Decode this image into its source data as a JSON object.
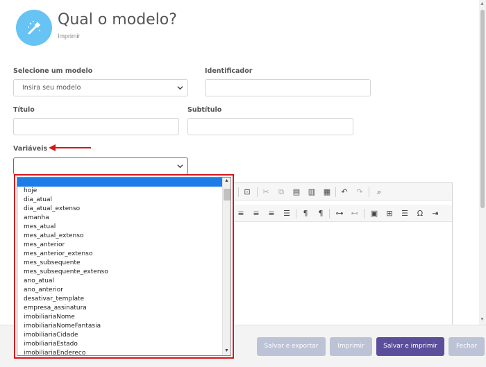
{
  "header": {
    "title": "Qual o modelo?",
    "subtitle": "Imprimir",
    "icon": "magic-wand-icon",
    "icon_bg": "#67c3f3"
  },
  "form": {
    "modelo_label": "Selecione um modelo",
    "modelo_value": "Insira seu modelo",
    "identificador_label": "Identificador",
    "identificador_value": "",
    "titulo_label": "Título",
    "titulo_value": "",
    "subtitulo_label": "Subtítulo",
    "subtitulo_value": "",
    "variaveis_label": "Variáveis",
    "variaveis_value": ""
  },
  "annotation": {
    "arrow_color": "#d6161b",
    "highlight_color": "#d6161b"
  },
  "dropdown": {
    "options": [
      "",
      "hoje",
      "dia_atual",
      "dia_atual_extenso",
      "amanha",
      "mes_atual",
      "mes_atual_extenso",
      "mes_anterior",
      "mes_anterior_extenso",
      "mes_subsequente",
      "mes_subsequente_extenso",
      "ano_atual",
      "ano_anterior",
      "desativar_template",
      "empresa_assinatura",
      "imobiliariaNome",
      "imobiliariaNomeFantasia",
      "imobiliariaCidade",
      "imobiliariaEstado",
      "imobiliariaEndereco"
    ],
    "selected_index": 0,
    "selected_color": "#1e7ce8"
  },
  "footer": {
    "save_export_label": "Salvar e exportar",
    "print_label": "Imprimir",
    "save_print_label": "Salvar e imprimir",
    "close_label": "Fechar",
    "primary_color": "#5b4f9c",
    "disabled_color": "#bcc3d6"
  }
}
